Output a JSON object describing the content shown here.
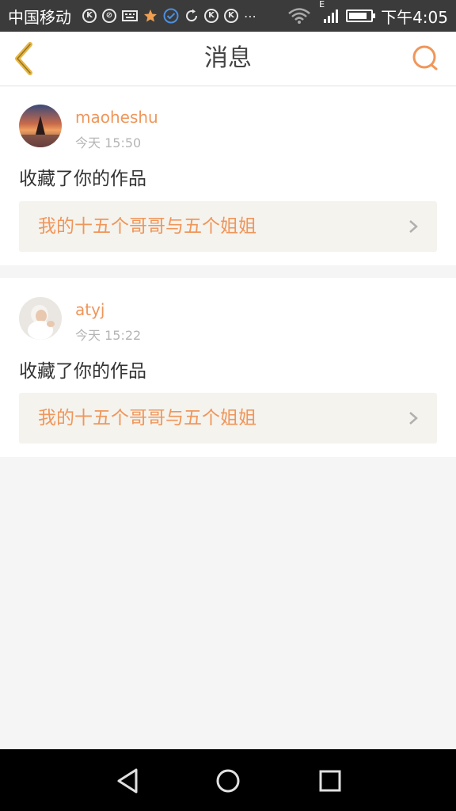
{
  "status_bar": {
    "carrier": "中国移动",
    "time": "下午4:05",
    "network_label": "E",
    "battery_level": 0.85
  },
  "header": {
    "title": "消息"
  },
  "messages": [
    {
      "user": "maoheshu",
      "time": "今天 15:50",
      "action": "收藏了你的作品",
      "work_title": "我的十五个哥哥与五个姐姐"
    },
    {
      "user": "atyj",
      "time": "今天 15:22",
      "action": "收藏了你的作品",
      "work_title": "我的十五个哥哥与五个姐姐"
    }
  ],
  "colors": {
    "accent": "#f0965a",
    "back_icon": "#e8b640",
    "link_bg": "#f4f3ee"
  },
  "icons": [
    "back-arrow-icon",
    "search-icon",
    "chevron-right-icon",
    "nav-back-icon",
    "nav-home-icon",
    "nav-recents-icon"
  ]
}
